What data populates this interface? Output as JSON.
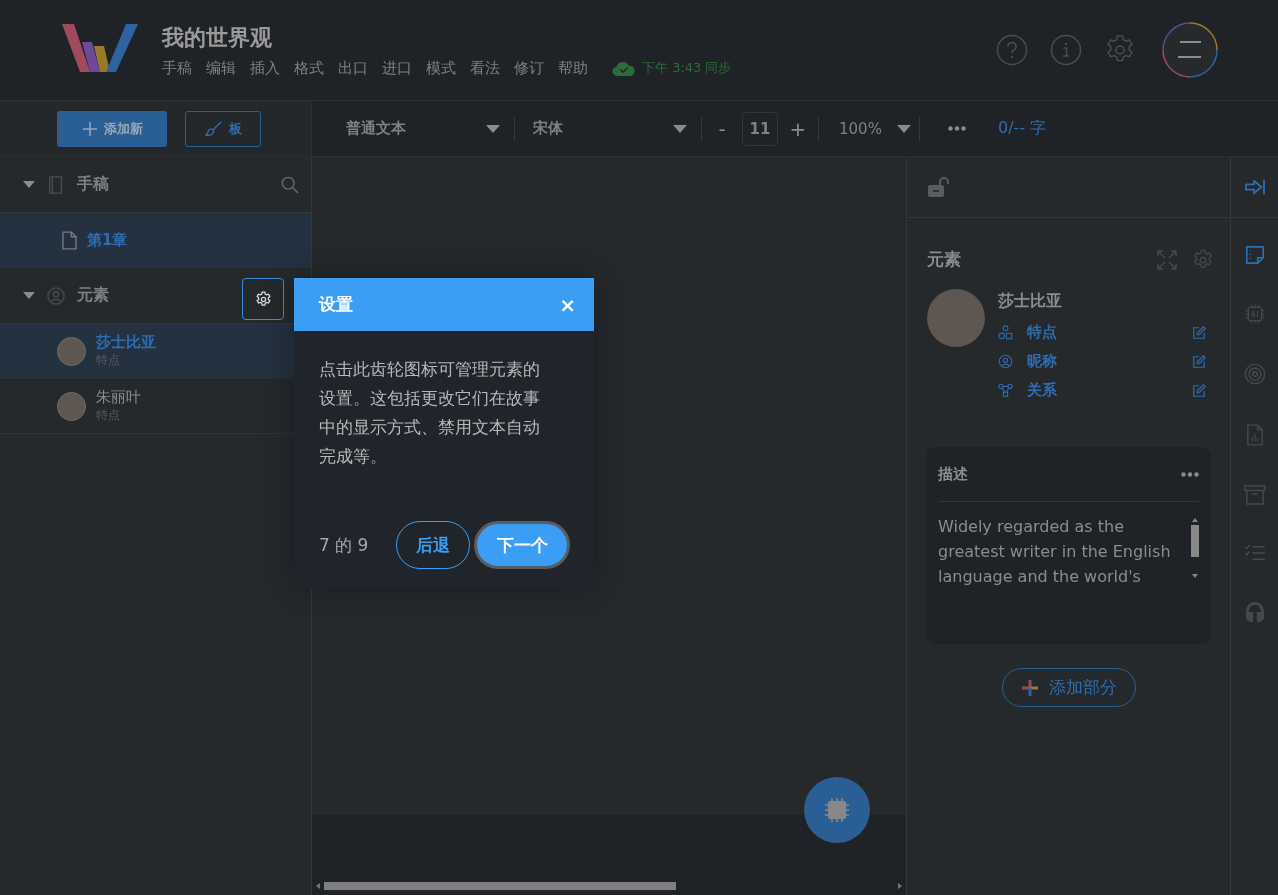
{
  "app": {
    "title": "我的世界观",
    "menu": [
      "手稿",
      "编辑",
      "插入",
      "格式",
      "出口",
      "进口",
      "模式",
      "看法",
      "修订",
      "帮助"
    ],
    "sync_status": "下午 3:43 同步"
  },
  "toolbar": {
    "add_button": "添加新",
    "board_button": "板",
    "style_select": "普通文本",
    "font_select": "宋体",
    "decrease": "-",
    "font_size": "11",
    "increase": "+",
    "zoom_select": "100%",
    "word_count": "0/-- 字"
  },
  "sidebar": {
    "sections": [
      {
        "title": "手稿",
        "kind": "manuscript",
        "expanded": true,
        "items": [
          {
            "name": "第1章",
            "kind": "chapter",
            "selected": true
          }
        ]
      },
      {
        "title": "元素",
        "kind": "elements",
        "expanded": true,
        "items": [
          {
            "name": "莎士比亚",
            "subtitle": "特点",
            "kind": "character",
            "selected": true
          },
          {
            "name": "朱丽叶",
            "subtitle": "特点",
            "kind": "character",
            "selected": false
          }
        ]
      }
    ]
  },
  "tour": {
    "title": "设置",
    "close": "×",
    "body": "点击此齿轮图标可管理元素的设置。这包括更改它们在故事中的显示方式、禁用文本自动完成等。",
    "progress": "7 的 9",
    "back": "后退",
    "next": "下一个"
  },
  "element_panel": {
    "title": "元素",
    "name": "莎士比亚",
    "fields": [
      {
        "label": "特点",
        "kind": "traits"
      },
      {
        "label": "昵称",
        "kind": "nickname"
      },
      {
        "label": "关系",
        "kind": "relations"
      }
    ],
    "description": {
      "title": "描述",
      "text": "Widely regarded as the greatest writer in the English language and the world's"
    },
    "add_section": "添加部分"
  }
}
